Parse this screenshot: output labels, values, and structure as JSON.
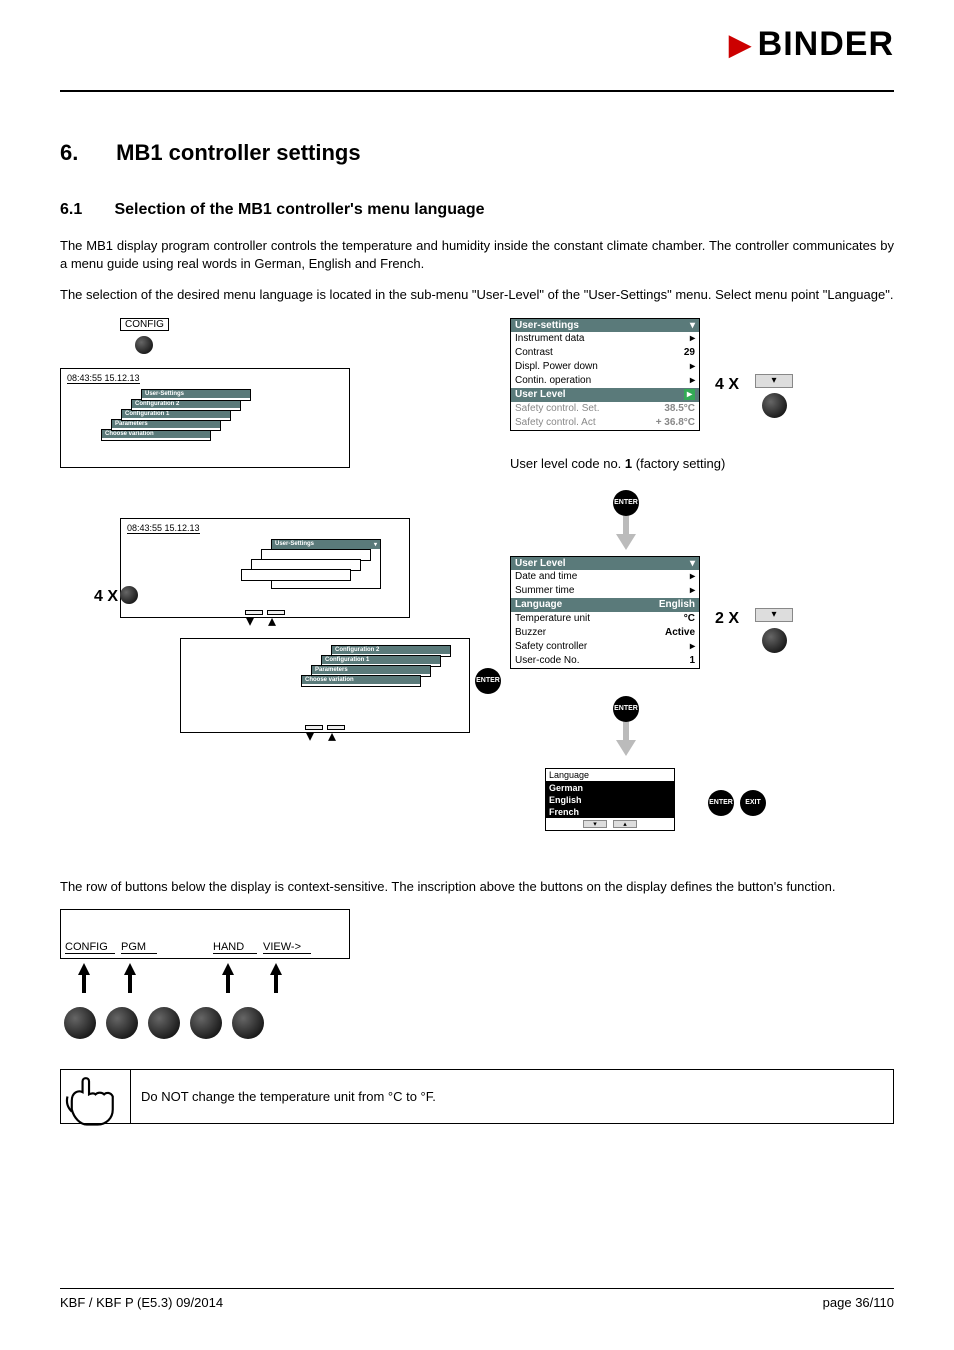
{
  "brand": "BINDER",
  "section_number": "6.",
  "section_title": "MB1 controller settings",
  "subsection_number": "6.1",
  "subsection_title": "Selection of the MB1 controller's menu language",
  "para1": "The MB1 display program controller controls the temperature and humidity inside the constant climate chamber. The controller communicates by a menu guide using real words in German, English and French.",
  "para2": "The selection of the desired menu language is located in the sub-menu \"User-Level\" of the \"User-Settings\" menu. Select menu point \"Language\".",
  "config_label": "CONFIG",
  "timestamp": "08:43:55  15.12.13",
  "stack_items": [
    "User-Settings",
    "Configuration 2",
    "Configuration 1",
    "Parameters",
    "Choose variation"
  ],
  "count_4x": "4 X",
  "count_2x": "2 X",
  "menu1": {
    "title": "User-settings",
    "rows": [
      {
        "label": "Instrument data",
        "val": "▸"
      },
      {
        "label": "Contrast",
        "val": "29"
      },
      {
        "label": "Displ. Power down",
        "val": "▸"
      },
      {
        "label": "Contin. operation",
        "val": "▸"
      },
      {
        "label": "User Level",
        "val": "▸",
        "hl": true
      },
      {
        "label": "Safety control. Set.",
        "val": "38.5°C",
        "dim": true
      },
      {
        "label": "Safety control. Act",
        "val": "+ 36.8°C",
        "dim": true
      }
    ]
  },
  "note_user_level": "User level code no. 1 (factory setting)",
  "note_user_level_bold": "1",
  "menu2": {
    "title": "User Level",
    "rows": [
      {
        "label": "Date and time",
        "val": "▸"
      },
      {
        "label": "Summer time",
        "val": "▸"
      },
      {
        "label": "Language",
        "val": "English",
        "hl": true
      },
      {
        "label": "Temperature unit",
        "val": "°C"
      },
      {
        "label": "Buzzer",
        "val": "Active"
      },
      {
        "label": "Safety controller",
        "val": "▸"
      },
      {
        "label": "User-code No.",
        "val": "1"
      }
    ]
  },
  "lang_menu": {
    "title": "Language",
    "options": [
      "German",
      "English",
      "French"
    ]
  },
  "enter_label": "ENTER",
  "exit_label": "EXIT",
  "para3": "The row of buttons below the display is context-sensitive. The inscription above the buttons on the display defines the button's function.",
  "button_labels": [
    "CONFIG",
    "PGM",
    "",
    "HAND",
    "VIEW->"
  ],
  "warning_text": "Do NOT change the temperature unit from °C to °F.",
  "footer_left": "KBF / KBF P (E5.3) 09/2014",
  "footer_right": "page 36/110"
}
